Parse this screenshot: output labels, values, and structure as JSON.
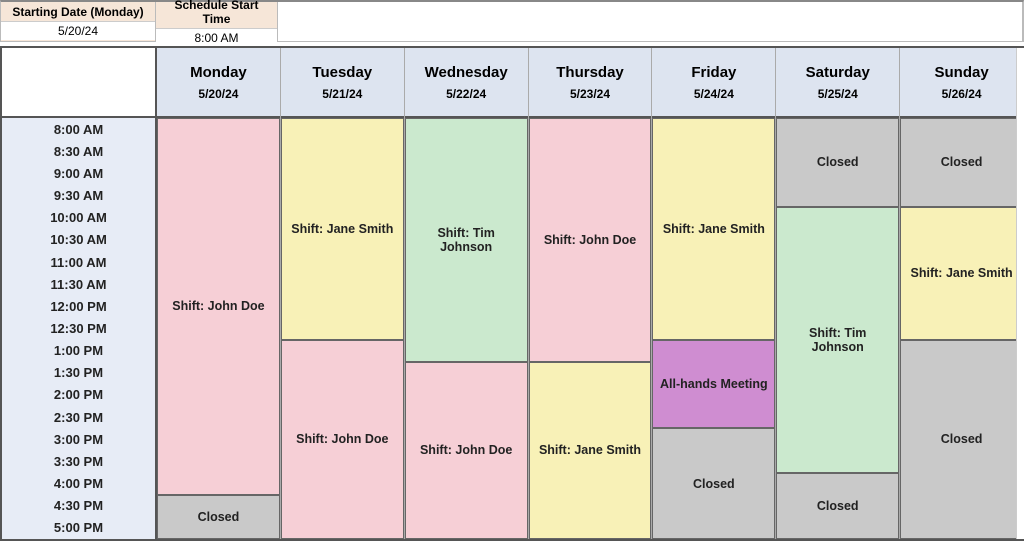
{
  "top": {
    "starting_date_label": "Starting Date (Monday)",
    "starting_date_value": "5/20/24",
    "start_time_label": "Schedule Start Time",
    "start_time_value": "8:00 AM"
  },
  "time_slots": [
    "8:00 AM",
    "8:30 AM",
    "9:00 AM",
    "9:30 AM",
    "10:00 AM",
    "10:30 AM",
    "11:00 AM",
    "11:30 AM",
    "12:00 PM",
    "12:30 PM",
    "1:00 PM",
    "1:30 PM",
    "2:00 PM",
    "2:30 PM",
    "3:00 PM",
    "3:30 PM",
    "4:00 PM",
    "4:30 PM",
    "5:00 PM"
  ],
  "days": [
    {
      "name": "Monday",
      "date": "5/20/24"
    },
    {
      "name": "Tuesday",
      "date": "5/21/24"
    },
    {
      "name": "Wednesday",
      "date": "5/22/24"
    },
    {
      "name": "Thursday",
      "date": "5/23/24"
    },
    {
      "name": "Friday",
      "date": "5/24/24"
    },
    {
      "name": "Saturday",
      "date": "5/25/24"
    },
    {
      "name": "Sunday",
      "date": "5/26/24"
    }
  ],
  "blocks": {
    "mon": [
      {
        "label": "Shift: John Doe",
        "color": "c-pink",
        "start": 0,
        "end": 17
      },
      {
        "label": "Closed",
        "color": "c-grey",
        "start": 17,
        "end": 19
      }
    ],
    "tue": [
      {
        "label": "Shift: Jane Smith",
        "color": "c-yellow",
        "start": 0,
        "end": 10
      },
      {
        "label": "Shift: John Doe",
        "color": "c-pink",
        "start": 10,
        "end": 19
      }
    ],
    "wed": [
      {
        "label": "Shift: Tim Johnson",
        "color": "c-green",
        "start": 0,
        "end": 11
      },
      {
        "label": "Shift: John Doe",
        "color": "c-pink",
        "start": 11,
        "end": 19
      }
    ],
    "thu": [
      {
        "label": "Shift: John Doe",
        "color": "c-pink",
        "start": 0,
        "end": 11
      },
      {
        "label": "Shift: Jane Smith",
        "color": "c-yellow",
        "start": 11,
        "end": 19
      }
    ],
    "fri": [
      {
        "label": "Shift: Jane Smith",
        "color": "c-yellow",
        "start": 0,
        "end": 10
      },
      {
        "label": "All-hands Meeting",
        "color": "c-purple",
        "start": 10,
        "end": 14
      },
      {
        "label": "Closed",
        "color": "c-grey",
        "start": 14,
        "end": 19
      }
    ],
    "sat": [
      {
        "label": "Closed",
        "color": "c-grey",
        "start": 0,
        "end": 4
      },
      {
        "label": "Shift: Tim Johnson",
        "color": "c-green",
        "start": 4,
        "end": 16
      },
      {
        "label": "Closed",
        "color": "c-grey",
        "start": 16,
        "end": 19
      }
    ],
    "sun": [
      {
        "label": "Closed",
        "color": "c-grey",
        "start": 0,
        "end": 4
      },
      {
        "label": "Shift: Jane Smith",
        "color": "c-yellow",
        "start": 4,
        "end": 10
      },
      {
        "label": "Closed",
        "color": "c-grey",
        "start": 10,
        "end": 19
      }
    ]
  },
  "slot_count": 19
}
